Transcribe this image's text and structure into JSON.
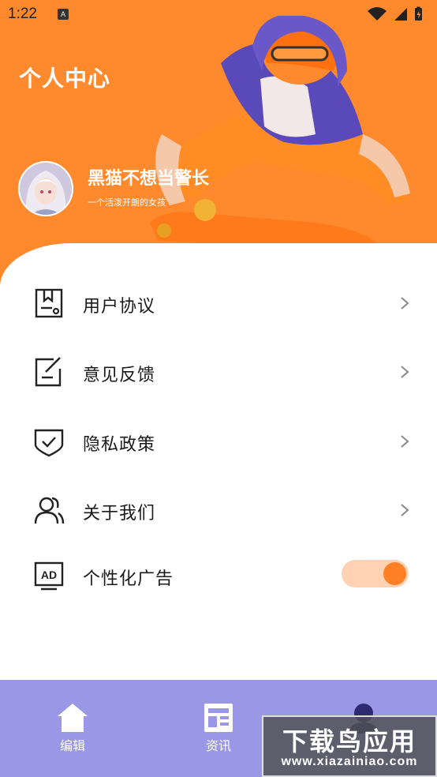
{
  "status_bar": {
    "time": "1:22",
    "notification_glyph": "A"
  },
  "header": {
    "title": "个人中心",
    "username": "黑猫不想当警长",
    "bio": "一个活泼开朗的女孩"
  },
  "menu": [
    {
      "label": "用户协议",
      "icon": "document-icon"
    },
    {
      "label": "意见反馈",
      "icon": "edit-note-icon"
    },
    {
      "label": "隐私政策",
      "icon": "shield-check-icon"
    },
    {
      "label": "关于我们",
      "icon": "users-icon"
    }
  ],
  "ad_setting": {
    "label": "个性化广告",
    "icon": "ad-icon",
    "enabled": true
  },
  "bottom_nav": [
    {
      "label": "编辑",
      "icon": "home-icon"
    },
    {
      "label": "资讯",
      "icon": "news-icon"
    },
    {
      "label": "",
      "icon": "profile-icon"
    }
  ],
  "watermark": {
    "title": "下载鸟应用",
    "url": "www.xiazainiao.com"
  },
  "colors": {
    "accent": "#ff8a2e",
    "nav_bg": "#9a97e6",
    "toggle_track": "#ffd2b3",
    "toggle_knob": "#ff7f27"
  }
}
